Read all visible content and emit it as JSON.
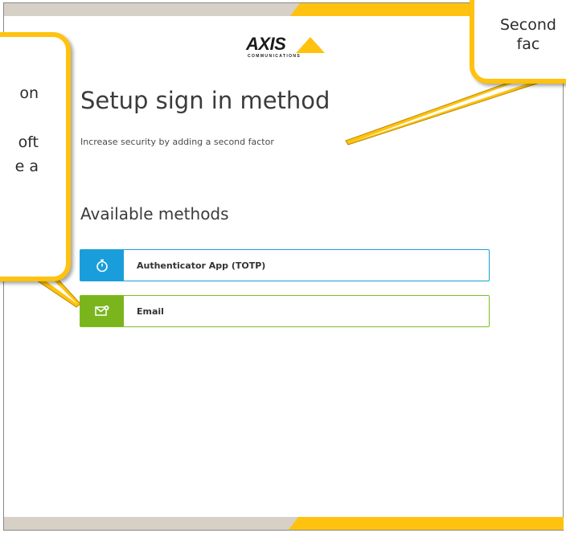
{
  "logo": {
    "word": "AXIS",
    "sub": "COMMUNICATIONS"
  },
  "page": {
    "title": "Setup sign in method",
    "subtitle": "Increase security by adding a second factor",
    "section_title": "Available methods"
  },
  "methods": [
    {
      "label": "Authenticator App (TOTP)",
      "icon": "stopwatch-icon",
      "color": "#1a9edb"
    },
    {
      "label": "Email",
      "icon": "email-icon",
      "color": "#7ab51d"
    }
  ],
  "callouts": {
    "left_text": "on\n\noft\ne a",
    "right_text": "Second\nfac"
  },
  "colors": {
    "accent_yellow": "#ffc20e",
    "band_gray": "#d6d0c7"
  }
}
